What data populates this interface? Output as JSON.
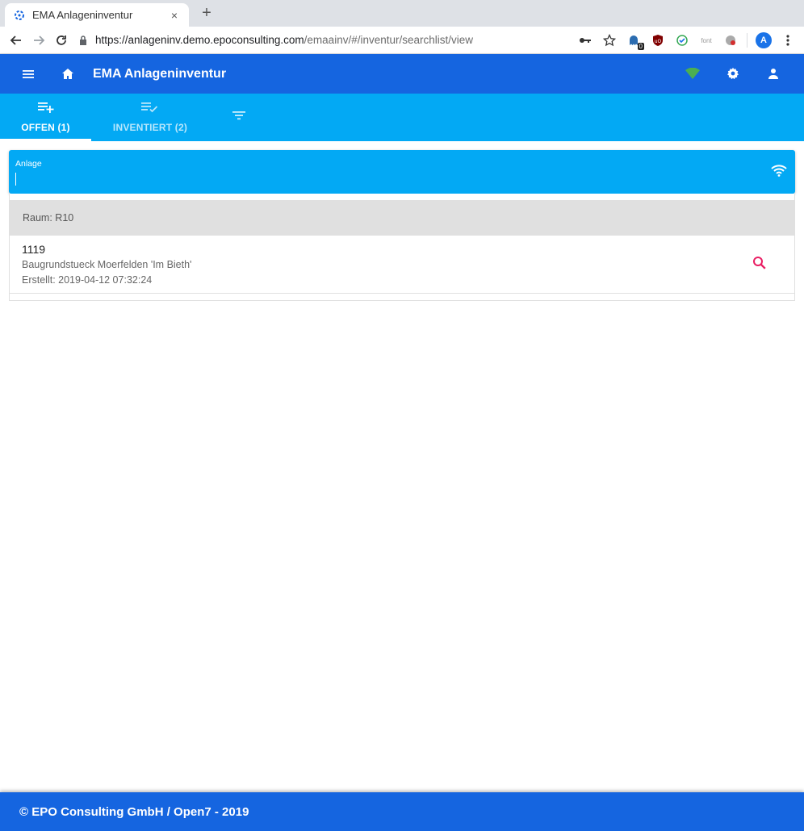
{
  "browser": {
    "tab_title": "EMA Anlageninventur",
    "tab_close": "×",
    "new_tab": "+",
    "url_domain": "https://anlageninv.demo.epoconsulting.com",
    "url_path": "/emaainv/#/inventur/searchlist/view",
    "extension_badge": "0",
    "font_ext_label": "font",
    "profile_initial": "A"
  },
  "header": {
    "title": "EMA Anlageninventur"
  },
  "tabs": [
    {
      "label": "OFFEN (1)",
      "icon": "playlist-add-icon",
      "active": true
    },
    {
      "label": "INVENTIERT (2)",
      "icon": "playlist-check-icon",
      "active": false
    }
  ],
  "search": {
    "label": "Anlage",
    "value": ""
  },
  "list": {
    "group_label": "Raum: R10",
    "items": [
      {
        "id": "1119",
        "description": "Baugrundstueck Moerfelden 'Im Bieth'",
        "created": "Erstellt: 2019-04-12 07:32:24"
      }
    ]
  },
  "footer": {
    "text": "© EPO Consulting GmbH / Open7 - 2019"
  },
  "colors": {
    "primary": "#1565e0",
    "accent": "#03a9f4",
    "status_online": "#4caf50",
    "action_search": "#e91e63"
  }
}
